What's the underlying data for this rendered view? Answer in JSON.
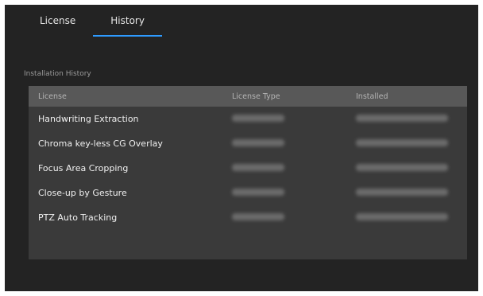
{
  "tabs": [
    {
      "label": "License",
      "active": false
    },
    {
      "label": "History",
      "active": true
    }
  ],
  "section_title": "Installation History",
  "table": {
    "headers": [
      "License",
      "License Type",
      "Installed"
    ],
    "rows": [
      {
        "license": "Handwriting Extraction",
        "license_type": "",
        "installed": ""
      },
      {
        "license": "Chroma key-less CG Overlay",
        "license_type": "",
        "installed": ""
      },
      {
        "license": "Focus Area Cropping",
        "license_type": "",
        "installed": ""
      },
      {
        "license": "Close-up by Gesture",
        "license_type": "",
        "installed": ""
      },
      {
        "license": "PTZ Auto Tracking",
        "license_type": "",
        "installed": ""
      }
    ]
  },
  "colors": {
    "background": "#232323",
    "panel": "#3a3a3a",
    "header": "#585858",
    "accent": "#2e9bff"
  }
}
